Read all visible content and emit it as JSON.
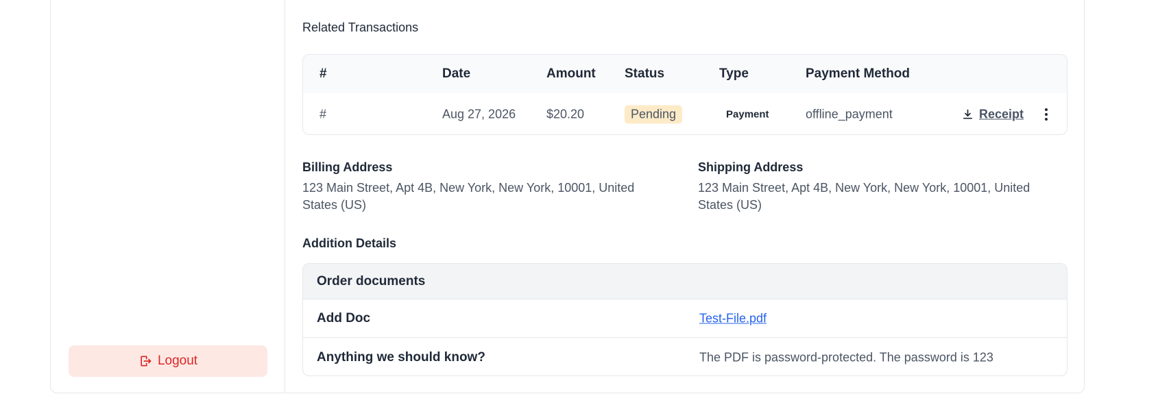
{
  "sidebar": {
    "logout_label": "Logout"
  },
  "transactions": {
    "title": "Related Transactions",
    "headers": {
      "num": "#",
      "date": "Date",
      "amount": "Amount",
      "status": "Status",
      "type": "Type",
      "method": "Payment Method"
    },
    "row": {
      "num": "#",
      "date": "Aug 27, 2026",
      "amount": "$20.20",
      "status": "Pending",
      "type": "Payment",
      "method": "offline_payment",
      "receipt_label": "Receipt"
    }
  },
  "billing": {
    "label": "Billing Address",
    "text": "123 Main Street, Apt 4B, New York, New York, 10001, United States (US)"
  },
  "shipping": {
    "label": "Shipping Address",
    "text": "123 Main Street, Apt 4B, New York, New York, 10001, United States (US)"
  },
  "details": {
    "title": "Addition Details",
    "table_title": "Order documents",
    "rows": [
      {
        "label": "Add Doc",
        "value": "Test-File.pdf"
      },
      {
        "label": "Anything we should know?",
        "value": "The PDF is password-protected. The password is 123"
      }
    ]
  },
  "colors": {
    "accent_link": "#2563eb",
    "danger": "#dc2626",
    "pending_bg": "#fdebc8",
    "pending_text": "#b45309"
  },
  "icons": {
    "logout": "logout-icon",
    "receipt": "download-icon",
    "menu": "kebab-menu-icon"
  }
}
